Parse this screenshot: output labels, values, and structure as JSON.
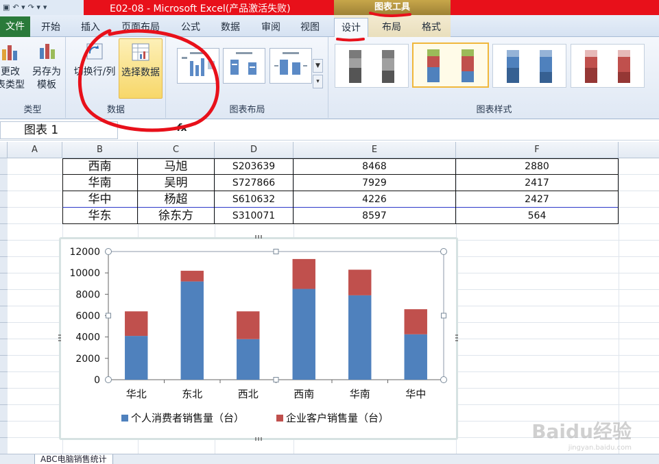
{
  "window": {
    "title": "E02-08 - Microsoft Excel(产品激活失败)",
    "context_tool": "图表工具"
  },
  "ribbon_tabs": {
    "file": "文件",
    "home": "开始",
    "insert": "插入",
    "page_layout": "页面布局",
    "formulas": "公式",
    "data": "数据",
    "review": "审阅",
    "view": "视图",
    "design": "设计",
    "layout": "布局",
    "format": "格式"
  },
  "ribbon": {
    "type_group": {
      "change_type": [
        "更改",
        "表类型"
      ],
      "save_template": [
        "另存为",
        "模板"
      ],
      "label": "类型"
    },
    "data_group": {
      "switch_row_col": "切换行/列",
      "select_data": "选择数据",
      "label": "数据"
    },
    "layout_group_label": "图表布局",
    "styles_group_label": "图表样式"
  },
  "formula_bar": {
    "name_box": "图表 1",
    "fx": "fx"
  },
  "columns": [
    "A",
    "B",
    "C",
    "D",
    "E",
    "F"
  ],
  "rows": [
    [
      "西南",
      "马旭",
      "S203639",
      "8468",
      "2880"
    ],
    [
      "华南",
      "吴明",
      "S727866",
      "7929",
      "2417"
    ],
    [
      "华中",
      "杨超",
      "S610632",
      "4226",
      "2427"
    ],
    [
      "华东",
      "徐东方",
      "S310071",
      "8597",
      "564"
    ]
  ],
  "chart_data": {
    "type": "bar",
    "stacked": true,
    "categories": [
      "华北",
      "东北",
      "西北",
      "西南",
      "华南",
      "华中"
    ],
    "series": [
      {
        "name": "个人消费者销售量（台）",
        "color": "#4f81bd",
        "values": [
          4100,
          9200,
          3800,
          8500,
          7900,
          4250
        ]
      },
      {
        "name": "企业客户销售量（台）",
        "color": "#c0504d",
        "values": [
          2300,
          1000,
          2600,
          2800,
          2400,
          2350
        ]
      }
    ],
    "yticks": [
      "0",
      "2000",
      "4000",
      "6000",
      "8000",
      "10000",
      "12000"
    ],
    "ylim": [
      0,
      12000
    ],
    "legend": "bottom"
  },
  "sheet_tab": "ABC电脑销售统计",
  "watermark": {
    "brand": "Baidu经验",
    "url": "jingyan.baidu.com"
  },
  "colors": {
    "title_red": "#e8101a",
    "annotation_red": "#e8101a",
    "file_tab_green": "#2a7a3a"
  }
}
